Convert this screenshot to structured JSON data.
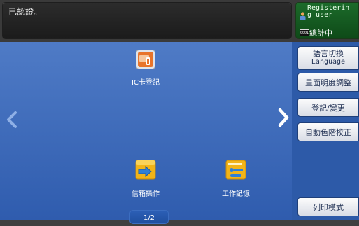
{
  "status_bar": {
    "message": "已認證。",
    "user_status": "Registerin\ng user",
    "meter_icon": "0001",
    "meter_label": "總計中"
  },
  "apps": {
    "ic_card": {
      "label": "IC卡登記",
      "icon": "ic-card-icon"
    },
    "mailbox": {
      "label": "信箱操作",
      "icon": "mailbox-icon"
    },
    "job_memory": {
      "label": "工作記憶",
      "icon": "job-memory-icon"
    }
  },
  "pagination": {
    "indicator": "1/2"
  },
  "side_menu": {
    "language": {
      "label": "語言切換",
      "sub": "Language"
    },
    "brightness": "畫面明度調整",
    "register_change": "登記/變更",
    "auto_gradation": "自動色階校正",
    "print_mode": "列印模式"
  },
  "colors": {
    "main_panel": "#3f6dbd",
    "side_panel": "#2d5aa8",
    "user_panel": "#1c6b2a"
  }
}
